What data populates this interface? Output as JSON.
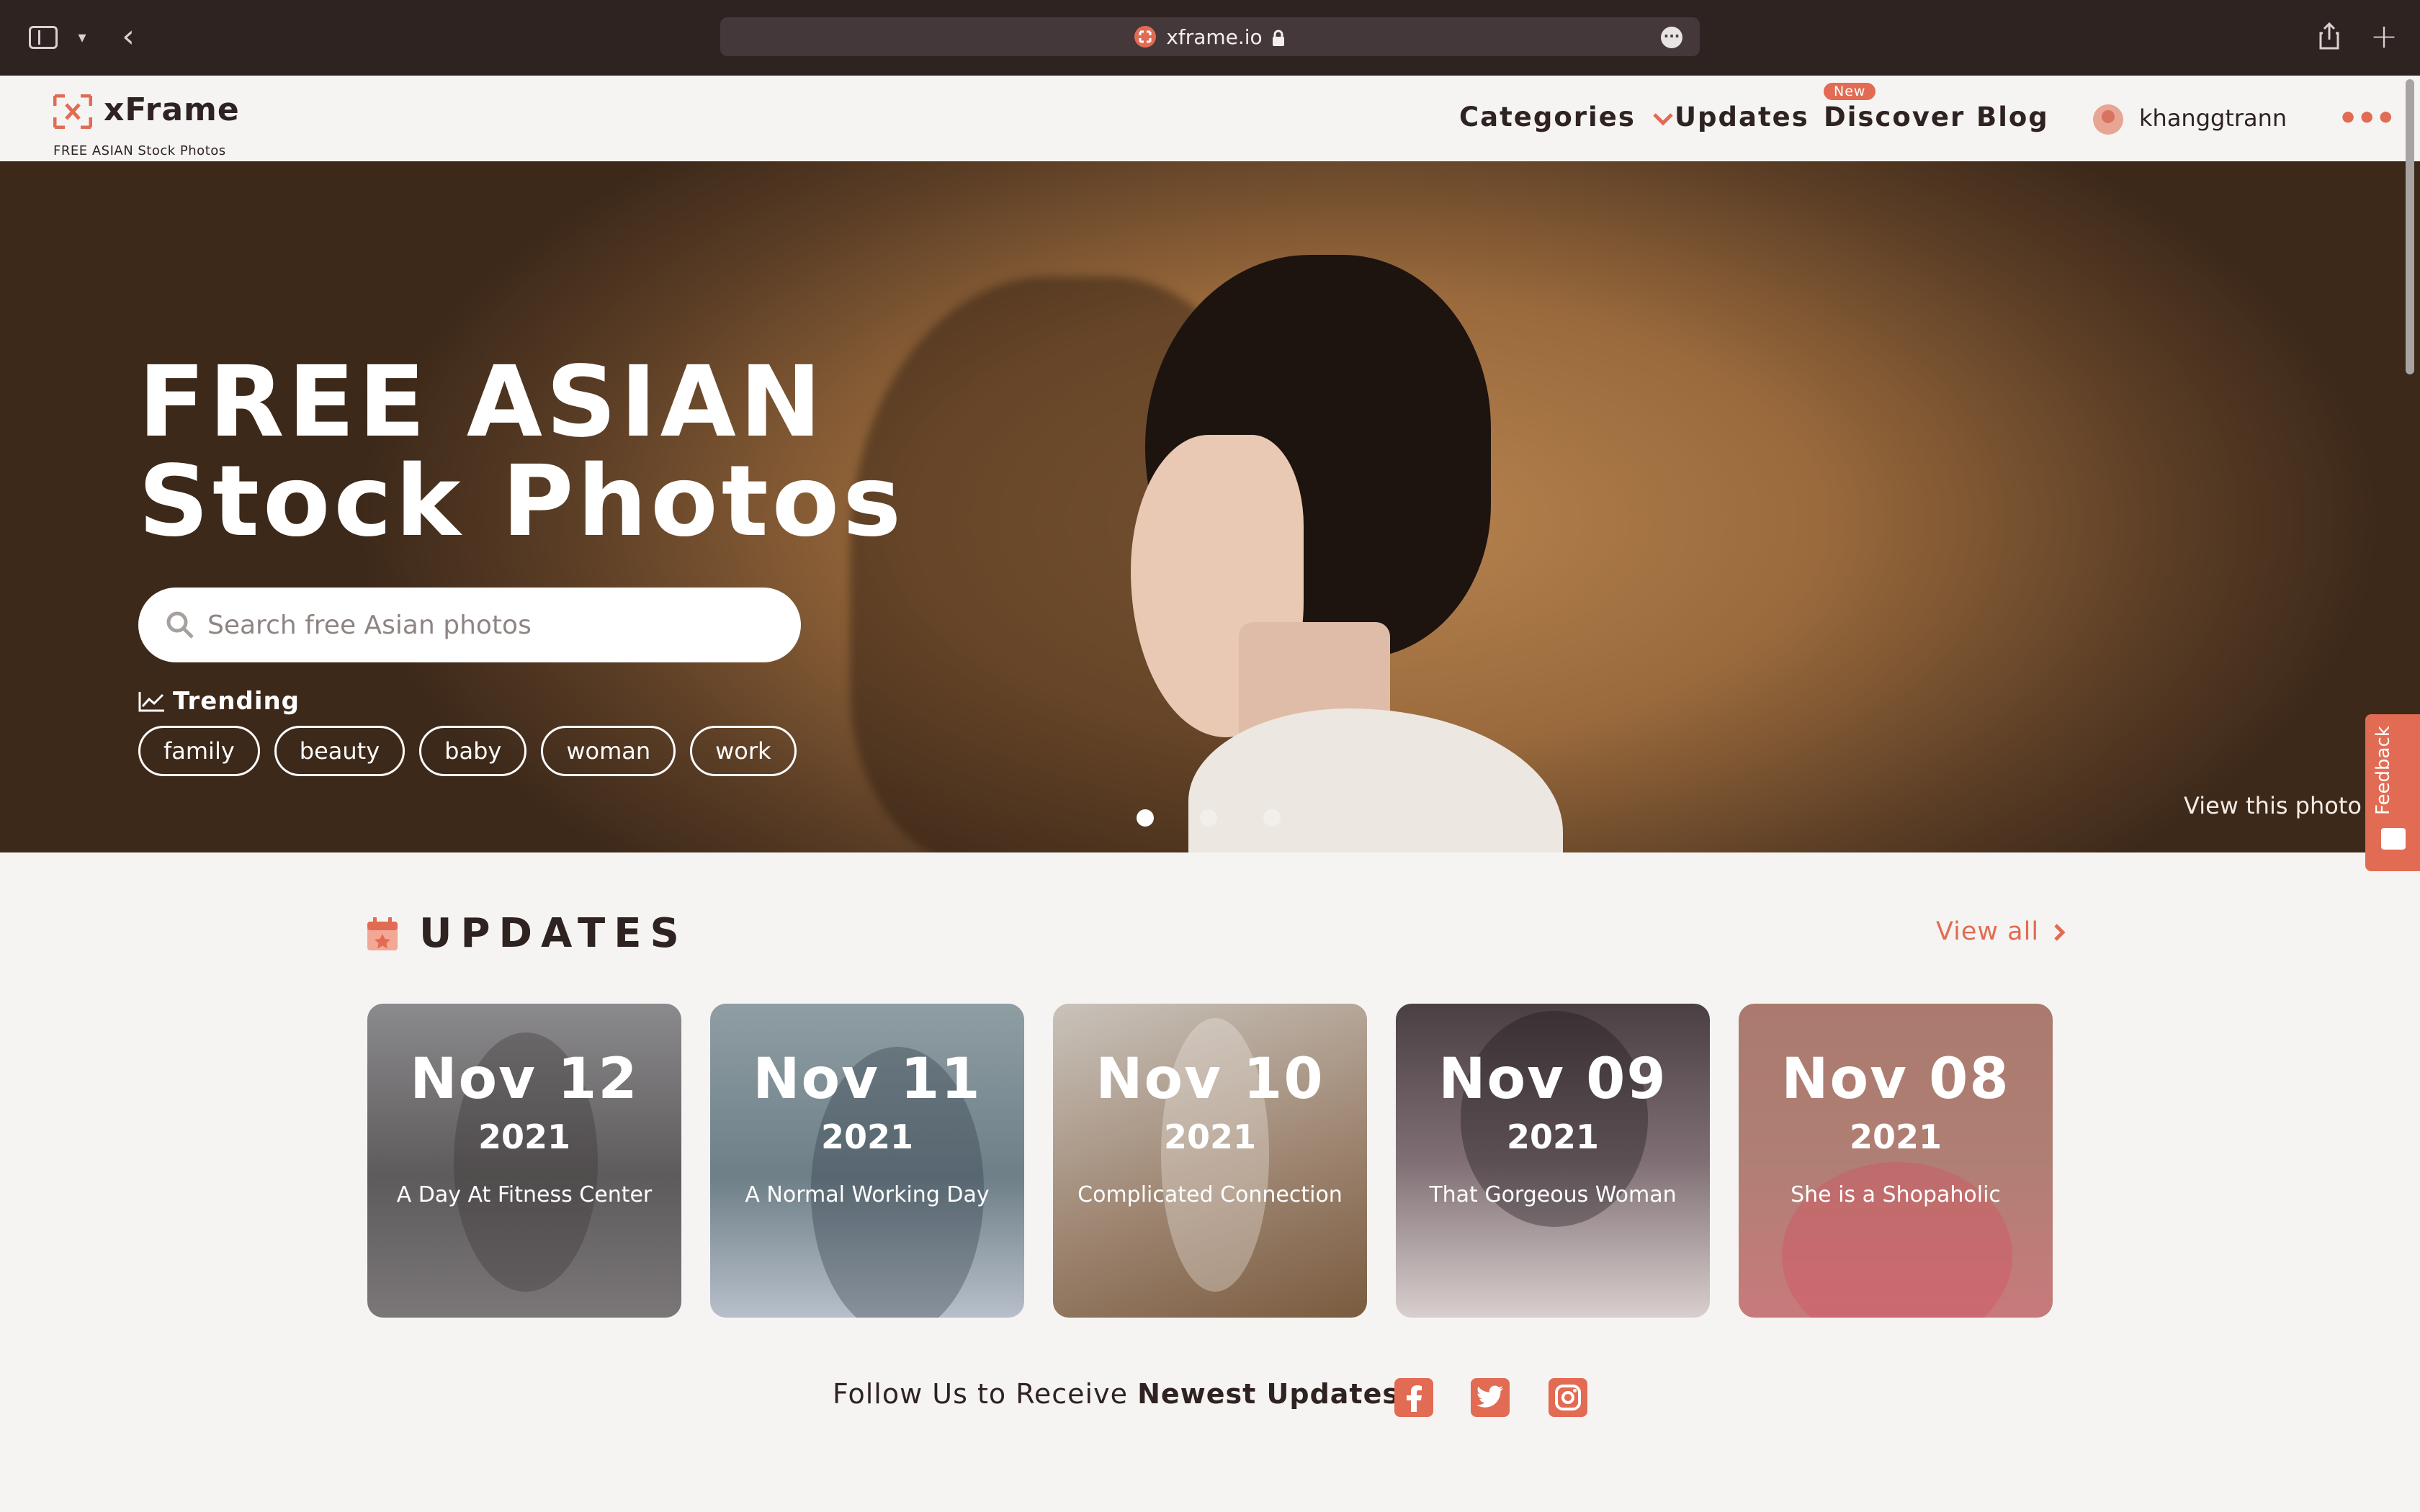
{
  "browser": {
    "url": "xframe.io"
  },
  "site": {
    "name": "xFrame",
    "tagline": "FREE ASIAN Stock Photos"
  },
  "nav": {
    "categories": "Categories",
    "updates": "Updates",
    "discover": "Discover",
    "discover_badge": "New",
    "blog": "Blog",
    "username": "khanggtrann"
  },
  "hero": {
    "title_line1": "FREE ASIAN",
    "title_line2": "Stock Photos",
    "search_placeholder": "Search free Asian photos",
    "trending_label": "Trending",
    "tags": [
      "family",
      "beauty",
      "baby",
      "woman",
      "work"
    ],
    "view_photo": "View this photo",
    "slide_count": 3,
    "active_slide": 1
  },
  "feedback": {
    "label": "Feedback"
  },
  "updates": {
    "title": "UPDATES",
    "view_all": "View all",
    "cards": [
      {
        "date": "Nov 12",
        "year": "2021",
        "caption": "A Day At Fitness Center"
      },
      {
        "date": "Nov 11",
        "year": "2021",
        "caption": "A Normal Working Day"
      },
      {
        "date": "Nov 10",
        "year": "2021",
        "caption": "Complicated Connection"
      },
      {
        "date": "Nov 09",
        "year": "2021",
        "caption": "That Gorgeous Woman"
      },
      {
        "date": "Nov 08",
        "year": "2021",
        "caption": "She is a Shopaholic"
      }
    ]
  },
  "follow": {
    "text": "Follow Us to Receive",
    "bold": "Newest Updates!"
  },
  "colors": {
    "accent": "#e26b53",
    "text": "#2f2322",
    "background": "#f5f4f2",
    "chrome": "#2f2322"
  }
}
